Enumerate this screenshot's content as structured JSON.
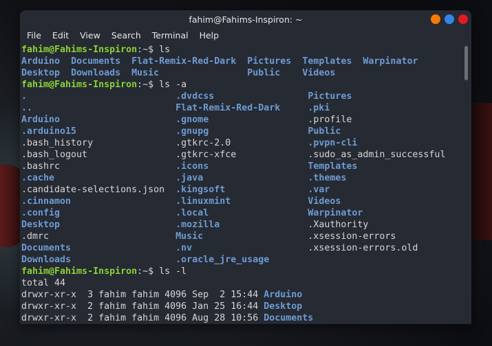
{
  "window": {
    "title": "fahim@Fahims-Inspiron: ~",
    "buttons": {
      "minimize_color": "#f57900",
      "maximize_color": "#3584e4",
      "close_color": "#e01b24"
    }
  },
  "menu": [
    "File",
    "Edit",
    "View",
    "Search",
    "Terminal",
    "Help"
  ],
  "colors": {
    "background": "#262a33",
    "prompt": "#8ad234",
    "directory": "#6e9bd2",
    "text": "#d6d6d6"
  },
  "terminal_lines": [
    [
      [
        "fahim@Fahims-Inspiron",
        "g"
      ],
      [
        ":~$ ls",
        "w"
      ]
    ],
    [
      [
        "Arduino",
        "b"
      ],
      [
        "  ",
        "w"
      ],
      [
        "Documents",
        "b"
      ],
      [
        "  ",
        "w"
      ],
      [
        "Flat-Remix-Red-Dark",
        "b"
      ],
      [
        "  ",
        "w"
      ],
      [
        "Pictures",
        "b"
      ],
      [
        "  ",
        "w"
      ],
      [
        "Templates",
        "b"
      ],
      [
        "  ",
        "w"
      ],
      [
        "Warpinator",
        "b"
      ]
    ],
    [
      [
        "Desktop",
        "b"
      ],
      [
        "  ",
        "w"
      ],
      [
        "Downloads",
        "b"
      ],
      [
        "  ",
        "w"
      ],
      [
        "Music",
        "b"
      ],
      [
        "                ",
        "w"
      ],
      [
        "Public",
        "b"
      ],
      [
        "    ",
        "w"
      ],
      [
        "Videos",
        "b"
      ]
    ],
    [
      [
        "fahim@Fahims-Inspiron",
        "g"
      ],
      [
        ":~$ ls -a",
        "w"
      ]
    ],
    [
      [
        ".",
        "b"
      ],
      [
        "                           ",
        "w"
      ],
      [
        ".dvdcss",
        "b"
      ],
      [
        "                 ",
        "w"
      ],
      [
        "Pictures",
        "b"
      ]
    ],
    [
      [
        "..",
        "b"
      ],
      [
        "                          ",
        "w"
      ],
      [
        "Flat-Remix-Red-Dark",
        "b"
      ],
      [
        "     ",
        "w"
      ],
      [
        ".pki",
        "b"
      ]
    ],
    [
      [
        "Arduino",
        "b"
      ],
      [
        "                     ",
        "w"
      ],
      [
        ".gnome",
        "b"
      ],
      [
        "                  ",
        "w"
      ],
      [
        ".profile",
        "w"
      ]
    ],
    [
      [
        ".arduino15",
        "b"
      ],
      [
        "                  ",
        "w"
      ],
      [
        ".gnupg",
        "b"
      ],
      [
        "                  ",
        "w"
      ],
      [
        "Public",
        "b"
      ]
    ],
    [
      [
        ".bash_history",
        "w"
      ],
      [
        "               ",
        "w"
      ],
      [
        ".gtkrc-2.0",
        "w"
      ],
      [
        "              ",
        "w"
      ],
      [
        ".pvpn-cli",
        "b"
      ]
    ],
    [
      [
        ".bash_logout",
        "w"
      ],
      [
        "                ",
        "w"
      ],
      [
        ".gtkrc-xfce",
        "w"
      ],
      [
        "             ",
        "w"
      ],
      [
        ".sudo_as_admin_successful",
        "w"
      ]
    ],
    [
      [
        ".bashrc",
        "w"
      ],
      [
        "                     ",
        "w"
      ],
      [
        ".icons",
        "b"
      ],
      [
        "                  ",
        "w"
      ],
      [
        "Templates",
        "b"
      ]
    ],
    [
      [
        ".cache",
        "b"
      ],
      [
        "                      ",
        "w"
      ],
      [
        ".java",
        "b"
      ],
      [
        "                   ",
        "w"
      ],
      [
        ".themes",
        "b"
      ]
    ],
    [
      [
        ".candidate-selections.json",
        "w"
      ],
      [
        "  ",
        "w"
      ],
      [
        ".kingsoft",
        "b"
      ],
      [
        "               ",
        "w"
      ],
      [
        ".var",
        "b"
      ]
    ],
    [
      [
        ".cinnamon",
        "b"
      ],
      [
        "                   ",
        "w"
      ],
      [
        ".linuxmint",
        "b"
      ],
      [
        "              ",
        "w"
      ],
      [
        "Videos",
        "b"
      ]
    ],
    [
      [
        ".config",
        "b"
      ],
      [
        "                     ",
        "w"
      ],
      [
        ".local",
        "b"
      ],
      [
        "                  ",
        "w"
      ],
      [
        "Warpinator",
        "b"
      ]
    ],
    [
      [
        "Desktop",
        "b"
      ],
      [
        "                     ",
        "w"
      ],
      [
        ".mozilla",
        "b"
      ],
      [
        "                ",
        "w"
      ],
      [
        ".Xauthority",
        "w"
      ]
    ],
    [
      [
        ".dmrc",
        "w"
      ],
      [
        "                       ",
        "w"
      ],
      [
        "Music",
        "b"
      ],
      [
        "                   ",
        "w"
      ],
      [
        ".xsession-errors",
        "w"
      ]
    ],
    [
      [
        "Documents",
        "b"
      ],
      [
        "                   ",
        "w"
      ],
      [
        ".nv",
        "b"
      ],
      [
        "                     ",
        "w"
      ],
      [
        ".xsession-errors.old",
        "w"
      ]
    ],
    [
      [
        "Downloads",
        "b"
      ],
      [
        "                   ",
        "w"
      ],
      [
        ".oracle_jre_usage",
        "b"
      ]
    ],
    [
      [
        "fahim@Fahims-Inspiron",
        "g"
      ],
      [
        ":~$ ls -l",
        "w"
      ]
    ],
    [
      [
        "total 44",
        "w"
      ]
    ],
    [
      [
        "drwxr-xr-x  3 fahim fahim 4096 Sep  2 15:44 ",
        "w"
      ],
      [
        "Arduino",
        "b"
      ]
    ],
    [
      [
        "drwxr-xr-x  2 fahim fahim 4096 Jan 25 16:44 ",
        "w"
      ],
      [
        "Desktop",
        "b"
      ]
    ],
    [
      [
        "drwxr-xr-x  2 fahim fahim 4096 Aug 28 10:56 ",
        "w"
      ],
      [
        "Documents",
        "b"
      ]
    ]
  ]
}
